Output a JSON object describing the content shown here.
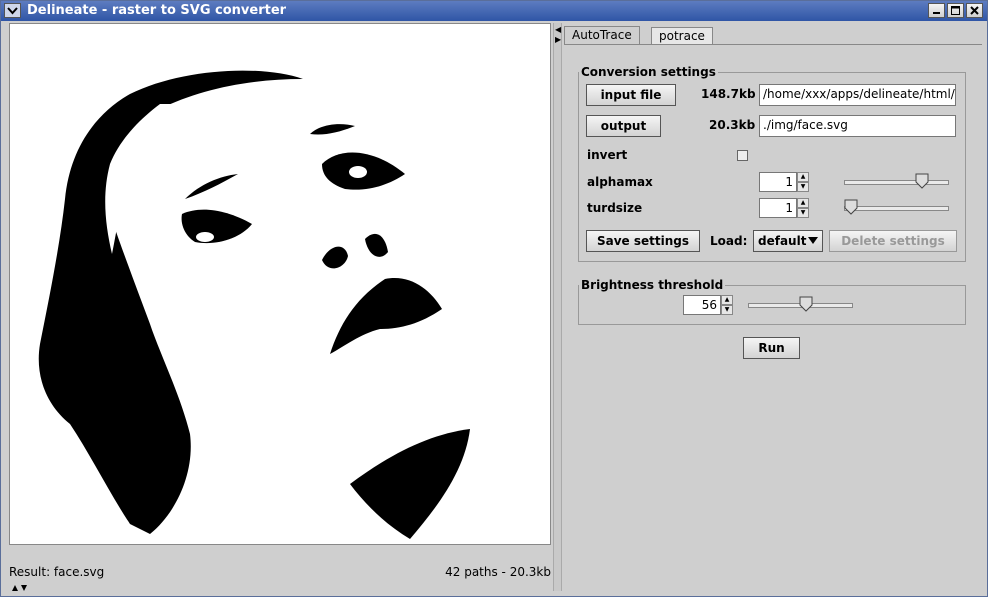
{
  "window": {
    "title": "Delineate - raster to SVG converter"
  },
  "tabs": [
    {
      "label": "AutoTrace"
    },
    {
      "label": "potrace"
    }
  ],
  "conversion": {
    "legend": "Conversion settings",
    "input_button": "input file",
    "input_size": "148.7kb",
    "input_path": "/home/xxx/apps/delineate/html/",
    "output_button": "output",
    "output_size": "20.3kb",
    "output_path": "./img/face.svg",
    "invert_label": "invert",
    "invert_checked": false,
    "alphamax_label": "alphamax",
    "alphamax_value": "1",
    "alphamax_slider_fraction": 0.78,
    "turdsize_label": "turdsize",
    "turdsize_value": "1",
    "turdsize_slider_fraction": 0.0,
    "save_button": "Save settings",
    "load_label": "Load:",
    "load_selected": "default",
    "delete_button": "Delete settings"
  },
  "brightness": {
    "legend": "Brightness threshold",
    "value": "56",
    "slider_fraction": 0.56
  },
  "run_button": "Run",
  "status": {
    "result": "Result: face.svg",
    "summary": "42 paths - 20.3kb"
  },
  "icons": {
    "window_menu": "chevron-down-icon",
    "minimize": "minimize-icon",
    "maximize": "maximize-icon",
    "close": "close-icon"
  }
}
